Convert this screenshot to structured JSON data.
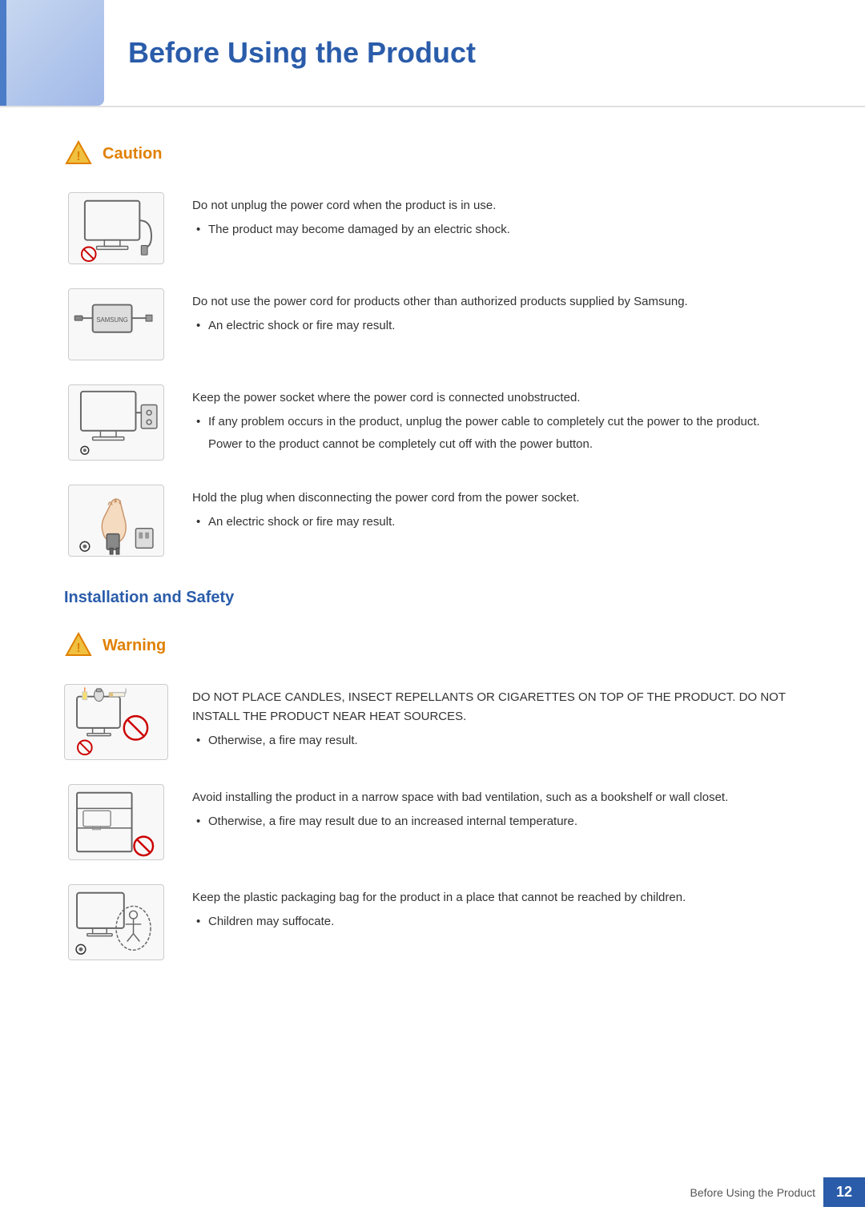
{
  "header": {
    "title": "Before Using the Product"
  },
  "caution_section": {
    "label": "Caution",
    "items": [
      {
        "id": "caution-1",
        "main_text": "Do not unplug the power cord when the product is in use.",
        "bullets": [
          "The product may become damaged by an electric shock."
        ],
        "sub_notes": []
      },
      {
        "id": "caution-2",
        "main_text": "Do not use the power cord for products other than authorized products supplied by Samsung.",
        "bullets": [
          "An electric shock or fire may result."
        ],
        "sub_notes": []
      },
      {
        "id": "caution-3",
        "main_text": "Keep the power socket where the power cord is connected unobstructed.",
        "bullets": [
          "If any problem occurs in the product, unplug the power cable to completely cut the power to the product."
        ],
        "sub_notes": [
          "Power to the product cannot be completely cut off with the power button."
        ]
      },
      {
        "id": "caution-4",
        "main_text": "Hold the plug when disconnecting the power cord from the power socket.",
        "bullets": [
          "An electric shock or fire may result."
        ],
        "sub_notes": []
      }
    ]
  },
  "installation_section": {
    "label": "Installation and Safety"
  },
  "warning_section": {
    "label": "Warning",
    "items": [
      {
        "id": "warning-1",
        "main_text": "DO NOT PLACE CANDLES, INSECT REPELLANTS OR CIGARETTES ON TOP OF THE PRODUCT. DO NOT INSTALL THE PRODUCT NEAR HEAT SOURCES.",
        "bullets": [
          "Otherwise, a fire may result."
        ],
        "sub_notes": []
      },
      {
        "id": "warning-2",
        "main_text": "Avoid installing the product in a narrow space with bad ventilation, such as a bookshelf or wall closet.",
        "bullets": [
          "Otherwise, a fire may result due to an increased internal temperature."
        ],
        "sub_notes": []
      },
      {
        "id": "warning-3",
        "main_text": "Keep the plastic packaging bag for the product in a place that cannot be reached by children.",
        "bullets": [
          "Children may suffocate."
        ],
        "sub_notes": []
      }
    ]
  },
  "footer": {
    "text": "Before Using the Product",
    "page_number": "12"
  }
}
